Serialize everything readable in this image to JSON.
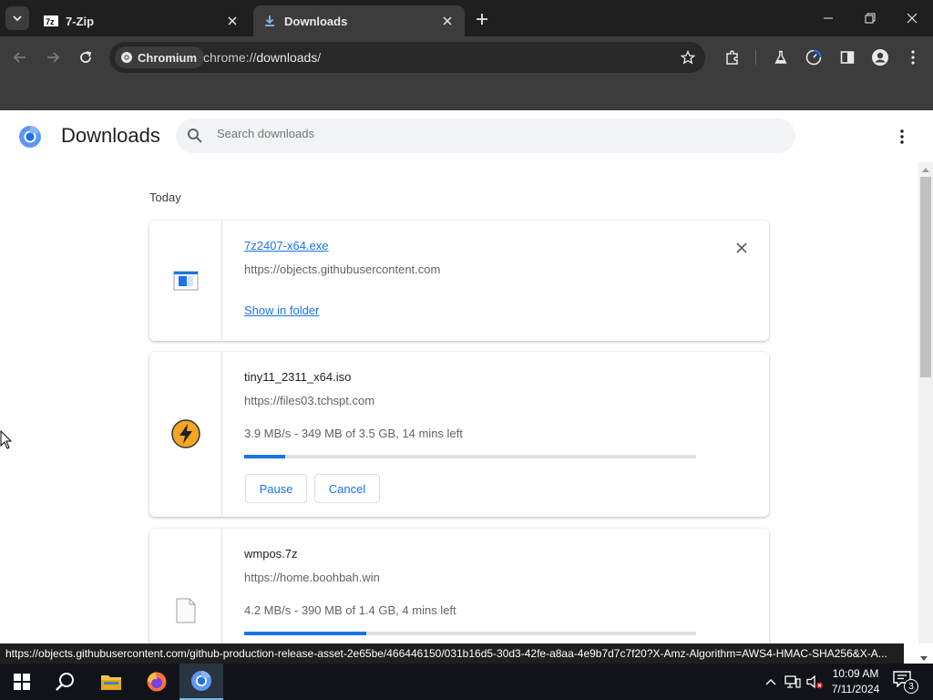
{
  "browser": {
    "tabs": [
      {
        "title": "7-Zip",
        "active": false
      },
      {
        "title": "Downloads",
        "active": true
      }
    ],
    "omnibox": {
      "chip_label": "Chromium",
      "url_prefix": "chrome://",
      "url_host": "downloads",
      "url_suffix": "/"
    }
  },
  "page": {
    "title": "Downloads",
    "search_placeholder": "Search downloads",
    "section_label": "Today",
    "downloads": [
      {
        "filename": "7z2407-x64.exe",
        "source": "https://objects.githubusercontent.com",
        "action": "Show in folder",
        "state": "complete"
      },
      {
        "filename": "tiny11_2311_x64.iso",
        "source": "https://files03.tchspt.com",
        "status": "3.9 MB/s - 349 MB of 3.5 GB, 14 mins left",
        "progress": 0.09,
        "pause_label": "Pause",
        "cancel_label": "Cancel",
        "state": "in-progress"
      },
      {
        "filename": "wmpos.7z",
        "source": "https://home.boohbah.win",
        "status": "4.2 MB/s - 390 MB of 1.4 GB, 4 mins left",
        "progress": 0.27,
        "state": "in-progress"
      }
    ]
  },
  "status_bar_url": "https://objects.githubusercontent.com/github-production-release-asset-2e65be/466446150/031b16d5-30d3-42fe-a8aa-4e9b7d7c7f20?X-Amz-Algorithm=AWS4-HMAC-SHA256&X-A...",
  "taskbar": {
    "time": "10:09 AM",
    "date": "7/11/2024",
    "notification_count": "3"
  },
  "colors": {
    "accent": "#1a73e8",
    "chrome_dark": "#3c3c3c"
  }
}
